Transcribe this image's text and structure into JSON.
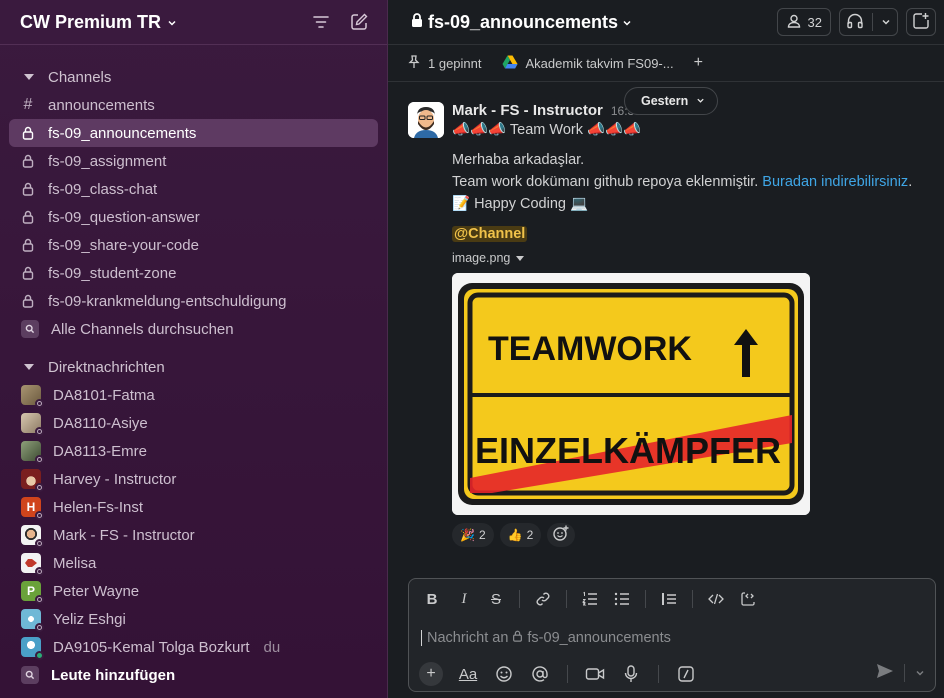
{
  "workspace": {
    "name": "CW Premium TR"
  },
  "sidebar": {
    "channels_header": "Channels",
    "channels": [
      {
        "name": "announcements",
        "type": "public"
      },
      {
        "name": "fs-09_announcements",
        "type": "private",
        "active": true
      },
      {
        "name": "fs-09_assignment",
        "type": "private"
      },
      {
        "name": "fs-09_class-chat",
        "type": "private"
      },
      {
        "name": "fs-09_question-answer",
        "type": "private"
      },
      {
        "name": "fs-09_share-your-code",
        "type": "private"
      },
      {
        "name": "fs-09_student-zone",
        "type": "private"
      },
      {
        "name": "fs-09-krankmeldung-entschuldigung",
        "type": "private"
      }
    ],
    "browse_channels": "Alle Channels durchsuchen",
    "dm_header": "Direktnachrichten",
    "dms": [
      {
        "name": "DA8101-Fatma",
        "color": "#8a7a5e"
      },
      {
        "name": "DA8110-Asiye",
        "color": "#b7a48c"
      },
      {
        "name": "DA8113-Emre",
        "color": "#6b7b5a"
      },
      {
        "name": "Harvey - Instructor",
        "color": "#7a1f1f"
      },
      {
        "name": "Helen-Fs-Inst",
        "color": "#d0441c",
        "initial": "H"
      },
      {
        "name": "Mark - FS - Instructor",
        "color": "#f3f3f3"
      },
      {
        "name": "Melisa",
        "color": "#e9e9e9"
      },
      {
        "name": "Peter Wayne",
        "color": "#6aa23a",
        "initial": "P"
      },
      {
        "name": "Yeliz Eshgi",
        "color": "#6fb8d6"
      },
      {
        "name": "DA9105-Kemal Tolga Bozkurt",
        "color": "#4aa0c8",
        "suffix": "du",
        "online": true
      }
    ],
    "add_people": "Leute hinzufügen"
  },
  "channel": {
    "title": "fs-09_announcements",
    "member_count": "32",
    "pinned": "1 gepinnt",
    "bookmark": "Akademik takvim FS09-..."
  },
  "message": {
    "author": "Mark - FS - Instructor",
    "time": "16:30 Uhr",
    "date_divider": "Gestern",
    "line1": "📣📣📣 Team Work 📣📣📣",
    "line2": "Merhaba arkadaşlar.",
    "line3_text": "Team work dokümanı github repoya eklenmiştir. ",
    "line3_link": "Buradan indirebilirsiniz",
    "line3_end": ".",
    "line4": "📝 Happy Coding 💻",
    "mention": "@Channel",
    "file_name": "image.png",
    "image_top": "TEAMWORK",
    "image_bottom": "EINZELKÄMPFER",
    "reactions": [
      {
        "emoji": "🎉",
        "count": "2"
      },
      {
        "emoji": "👍",
        "count": "2"
      }
    ]
  },
  "composer": {
    "placeholder_prefix": "Nachricht an ",
    "placeholder_channel": "fs-09_announcements",
    "text_style": "Aa"
  }
}
